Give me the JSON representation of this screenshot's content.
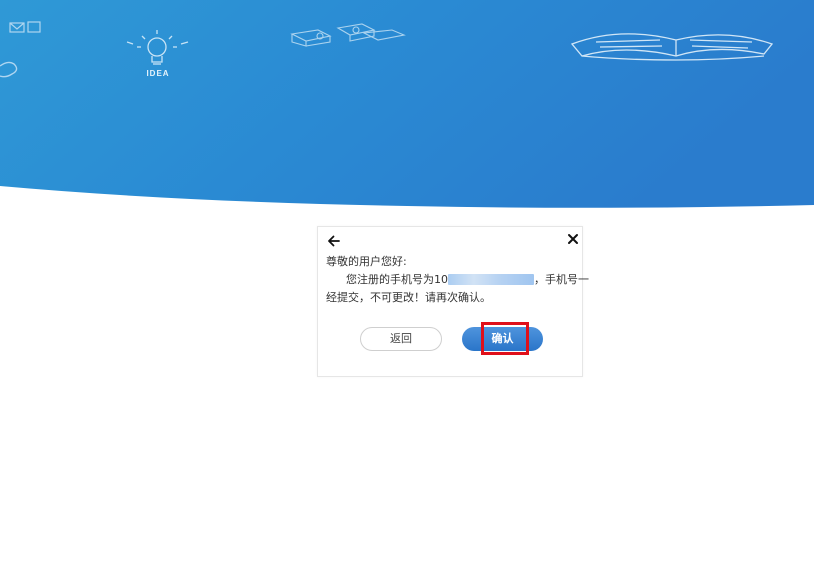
{
  "banner": {
    "idea_text": "IDEA",
    "gradient_start": "#2f93d4",
    "gradient_end": "#2a80d0"
  },
  "dialog": {
    "greeting": "尊敬的用户您好:",
    "message_part1": "您注册的手机号为",
    "phone_visible": "10",
    "message_part2": "，手机号一",
    "message_line2": "经提交，不可更改！请再次确认。",
    "back_label": "返回",
    "confirm_label": "确认"
  },
  "colors": {
    "accent": "#2a75c9",
    "highlight": "#e0101a",
    "text": "#333333"
  },
  "icons": {
    "back": "arrow-left-icon",
    "close": "close-icon"
  }
}
